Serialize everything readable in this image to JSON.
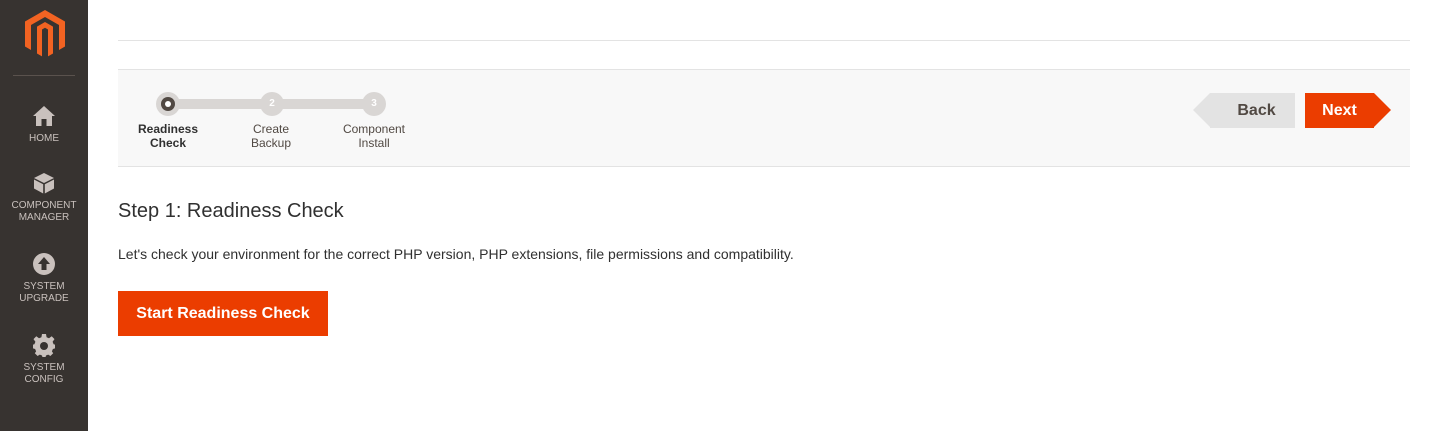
{
  "sidebar": {
    "items": [
      {
        "label_line1": "HOME",
        "label_line2": "",
        "icon": "home-icon"
      },
      {
        "label_line1": "COMPONENT",
        "label_line2": "MANAGER",
        "icon": "cube-icon"
      },
      {
        "label_line1": "SYSTEM",
        "label_line2": "UPGRADE",
        "icon": "upgrade-icon"
      },
      {
        "label_line1": "SYSTEM",
        "label_line2": "CONFIG",
        "icon": "gear-icon"
      }
    ]
  },
  "wizard": {
    "steps": [
      {
        "number": "",
        "label_line1": "Readiness",
        "label_line2": "Check",
        "active": true
      },
      {
        "number": "2",
        "label_line1": "Create",
        "label_line2": "Backup",
        "active": false
      },
      {
        "number": "3",
        "label_line1": "Component",
        "label_line2": "Install",
        "active": false
      }
    ],
    "back_label": "Back",
    "next_label": "Next"
  },
  "content": {
    "title": "Step 1: Readiness Check",
    "description": "Let's check your environment for the correct PHP version, PHP extensions, file permissions and compatibility.",
    "start_button": "Start Readiness Check"
  },
  "colors": {
    "sidebar_bg": "#373330",
    "accent": "#eb3d00",
    "logo": "#f26322"
  }
}
